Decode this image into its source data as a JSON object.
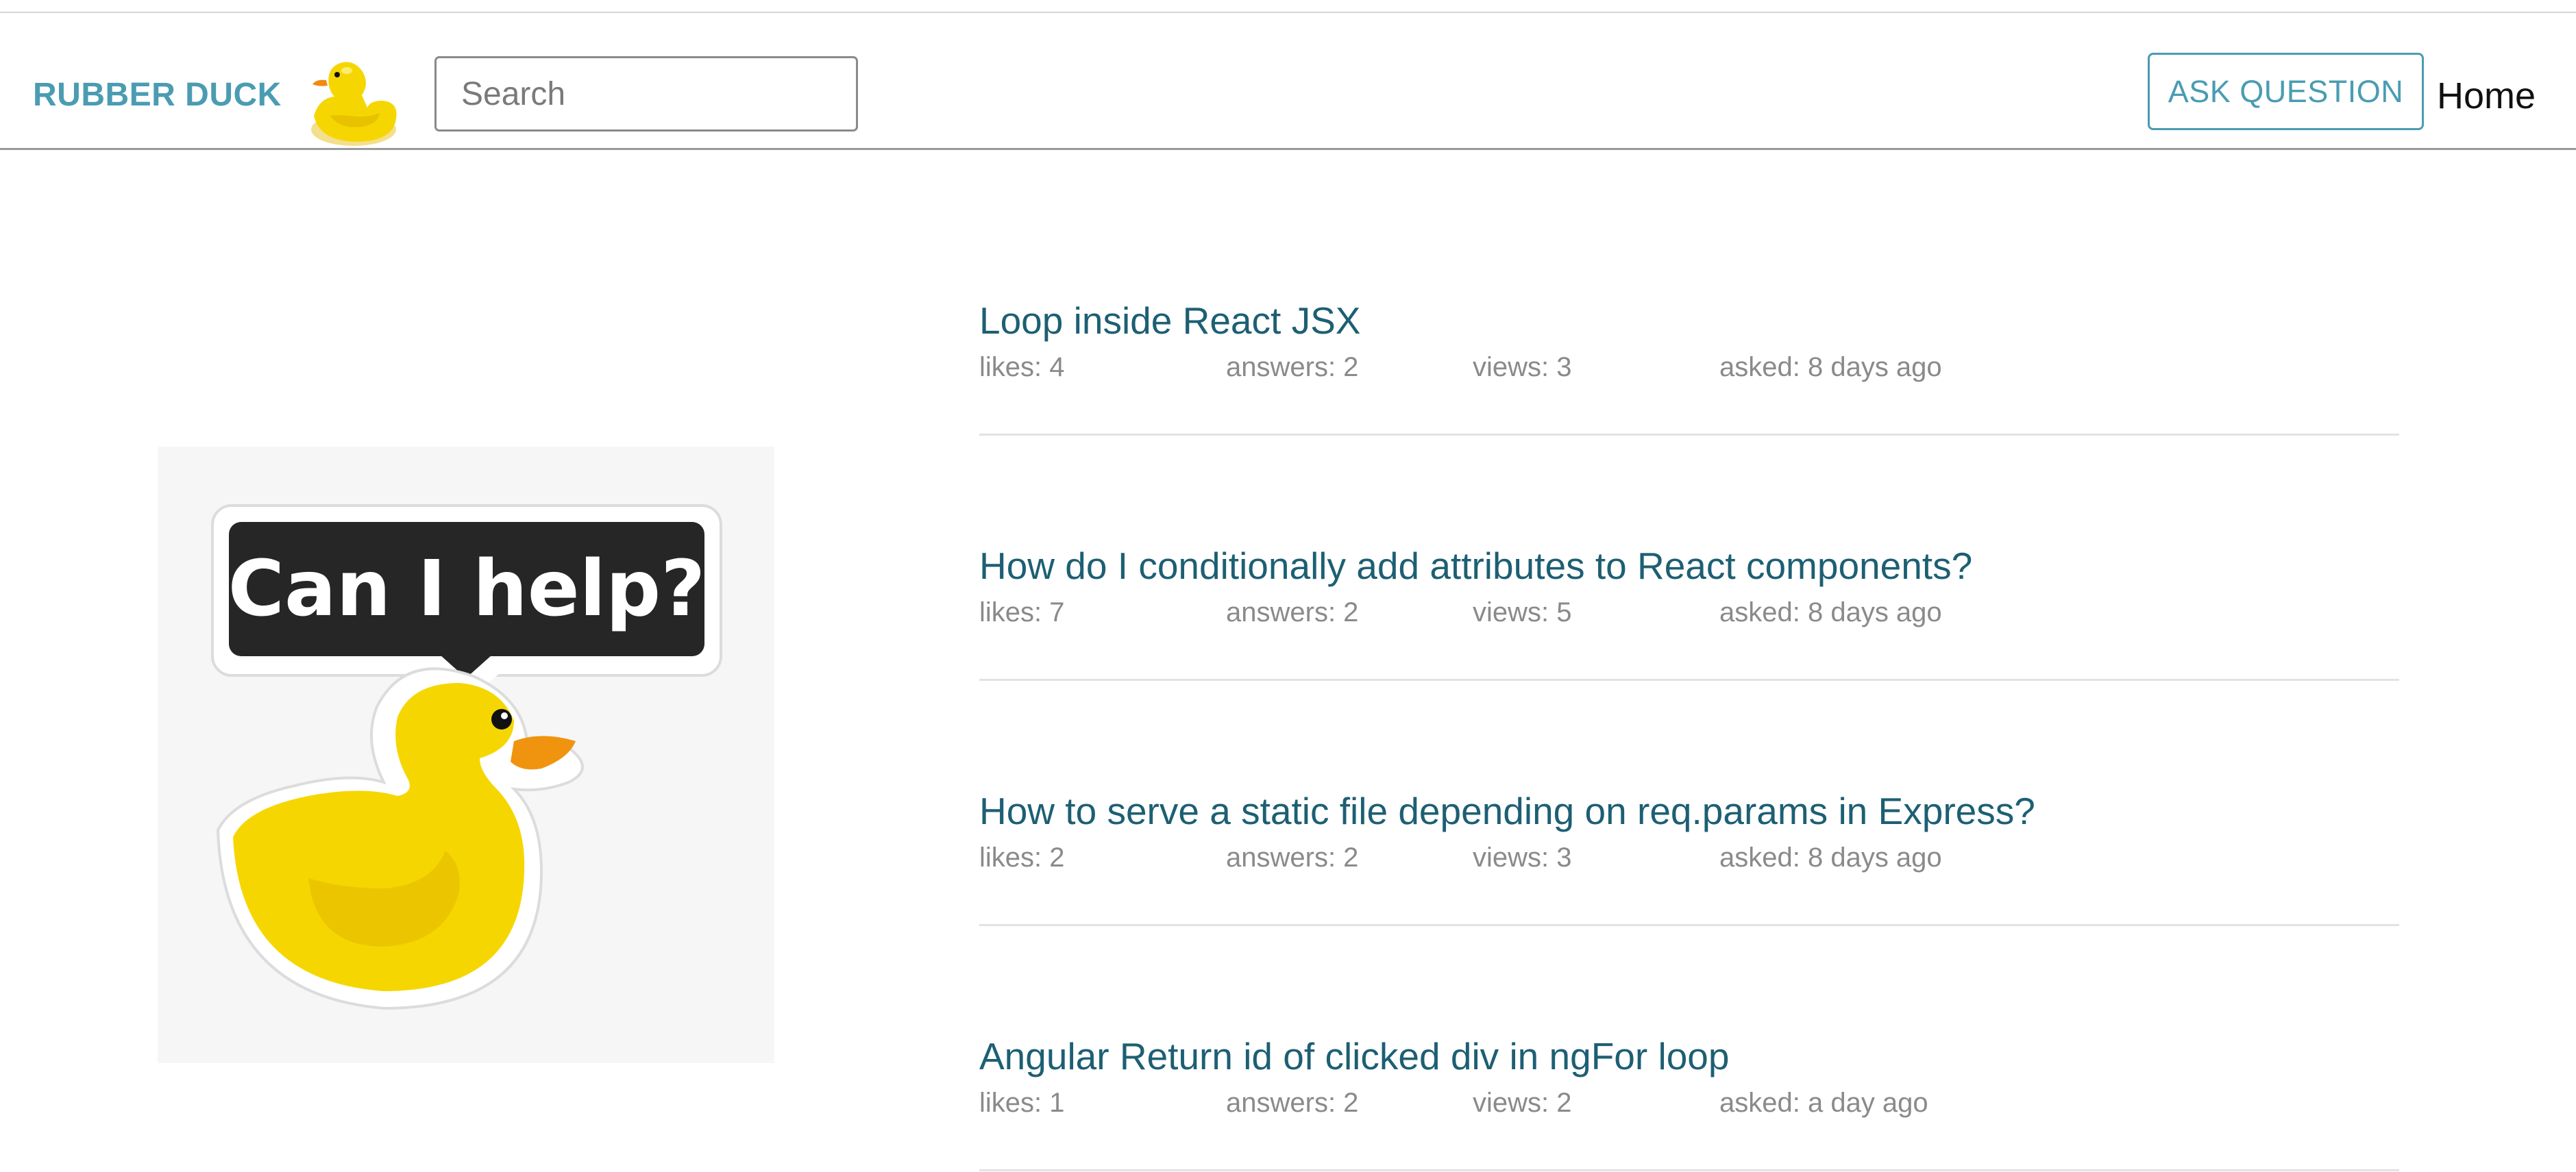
{
  "header": {
    "brand": "RUBBER DUCK",
    "search_placeholder": "Search",
    "ask_button": "ASK QUESTION",
    "home_link": "Home"
  },
  "promo": {
    "bubble_text": "Can I help?"
  },
  "questions": [
    {
      "title": "Loop inside React JSX",
      "likes": "likes: 4",
      "answers": "answers: 2",
      "views": "views: 3",
      "asked": "asked: 8 days ago"
    },
    {
      "title": "How do I conditionally add attributes to React components?",
      "likes": "likes: 7",
      "answers": "answers: 2",
      "views": "views: 5",
      "asked": "asked: 8 days ago"
    },
    {
      "title": "How to serve a static file depending on req.params in Express?",
      "likes": "likes: 2",
      "answers": "answers: 2",
      "views": "views: 3",
      "asked": "asked: 8 days ago"
    },
    {
      "title": "Angular Return id of clicked div in ngFor loop",
      "likes": "likes: 1",
      "answers": "answers: 2",
      "views": "views: 2",
      "asked": "asked: a day ago"
    }
  ],
  "colors": {
    "brand": "#4a9cb2",
    "title_link": "#1d5f73",
    "meta_text": "#8a8a8a",
    "duck_yellow": "#f6d600",
    "bubble_dark": "#262626"
  }
}
